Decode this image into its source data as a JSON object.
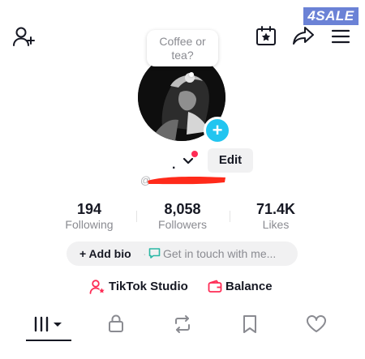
{
  "watermark": "4SALE",
  "header": {
    "left_icon": "add-user-icon",
    "right_icons": [
      "calendar-star-icon",
      "share-icon",
      "menu-icon"
    ]
  },
  "profile": {
    "note_bubble": [
      "Coffee or",
      "tea?"
    ],
    "display_name": ".",
    "edit_label": "Edit",
    "handle_prefix": "@"
  },
  "stats": [
    {
      "value": "194",
      "label": "Following"
    },
    {
      "value": "8,058",
      "label": "Followers"
    },
    {
      "value": "71.4K",
      "label": "Likes"
    }
  ],
  "bio": {
    "add_label": "+ Add bio",
    "separator": "·",
    "placeholder": "Get in touch with me..."
  },
  "links": {
    "studio_label": "TikTok Studio",
    "balance_label": "Balance"
  },
  "tabs": [
    "videos-grid-icon",
    "lock-icon",
    "repost-icon",
    "bookmark-icon",
    "heart-icon"
  ],
  "colors": {
    "accent_red": "#fe2c55",
    "plus_blue": "#22c5f0",
    "watermark_bg": "#6b82d6",
    "redaction": "#ff2a1a"
  }
}
